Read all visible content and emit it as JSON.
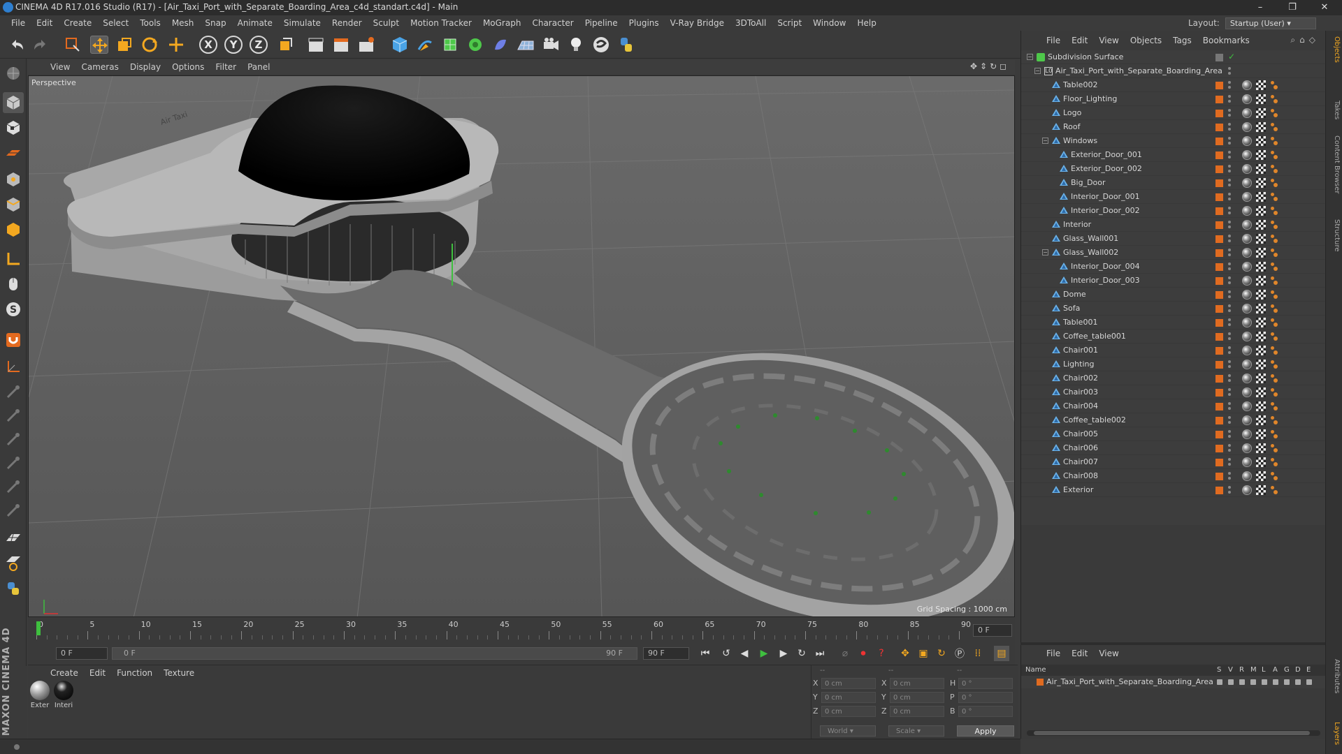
{
  "window": {
    "title": "CINEMA 4D R17.016 Studio (R17) - [Air_Taxi_Port_with_Separate_Boarding_Area_c4d_standart.c4d] - Main",
    "minimize": "–",
    "maximize": "❐",
    "close": "✕"
  },
  "menu": [
    "File",
    "Edit",
    "Create",
    "Select",
    "Tools",
    "Mesh",
    "Snap",
    "Animate",
    "Simulate",
    "Render",
    "Sculpt",
    "Motion Tracker",
    "MoGraph",
    "Character",
    "Pipeline",
    "Plugins",
    "V-Ray Bridge",
    "3DToAll",
    "Script",
    "Window",
    "Help"
  ],
  "layout": {
    "label": "Layout:",
    "value": "Startup (User)"
  },
  "toolbar_axes": [
    "X",
    "Y",
    "Z"
  ],
  "viewport": {
    "menu": [
      "View",
      "Cameras",
      "Display",
      "Options",
      "Filter",
      "Panel"
    ],
    "label": "Perspective",
    "grid_spacing": "Grid Spacing : 1000 cm"
  },
  "timeline": {
    "ticks": [
      "0",
      "5",
      "10",
      "15",
      "20",
      "25",
      "30",
      "35",
      "40",
      "45",
      "50",
      "55",
      "60",
      "65",
      "70",
      "75",
      "80",
      "85",
      "90"
    ],
    "current_frame": "0 F",
    "start_field": "0 F",
    "range_start": "0 F",
    "range_end": "90 F",
    "end_field": "90 F"
  },
  "materials": {
    "menu": [
      "Create",
      "Edit",
      "Function",
      "Texture"
    ],
    "items": [
      {
        "label": "Exter"
      },
      {
        "label": "Interi"
      }
    ]
  },
  "coords": {
    "headers": [
      "--",
      "--",
      "--"
    ],
    "rows": [
      {
        "a": "X",
        "av": "0 cm",
        "b": "X",
        "bv": "0 cm",
        "c": "H",
        "cv": "0 °"
      },
      {
        "a": "Y",
        "av": "0 cm",
        "b": "Y",
        "bv": "0 cm",
        "c": "P",
        "cv": "0 °"
      },
      {
        "a": "Z",
        "av": "0 cm",
        "b": "Z",
        "bv": "0 cm",
        "c": "B",
        "cv": "0 °"
      }
    ],
    "world": "World",
    "scale": "Scale",
    "apply": "Apply"
  },
  "objects": {
    "menu": [
      "File",
      "Edit",
      "View",
      "Objects",
      "Tags",
      "Bookmarks"
    ],
    "tree": [
      {
        "name": "Subdivision Surface",
        "level": 0,
        "type": "subdiv",
        "tags": false
      },
      {
        "name": "Air_Taxi_Port_with_Separate_Boarding_Area",
        "level": 1,
        "type": "null",
        "tags": false
      },
      {
        "name": "Table002",
        "level": 2,
        "type": "obj",
        "tags": true
      },
      {
        "name": "Floor_Lighting",
        "level": 2,
        "type": "obj",
        "tags": true
      },
      {
        "name": "Logo",
        "level": 2,
        "type": "obj",
        "tags": true
      },
      {
        "name": "Roof",
        "level": 2,
        "type": "obj",
        "tags": true
      },
      {
        "name": "Windows",
        "level": 2,
        "type": "obj",
        "tags": true,
        "expanded": true
      },
      {
        "name": "Exterior_Door_001",
        "level": 3,
        "type": "obj",
        "tags": true
      },
      {
        "name": "Exterior_Door_002",
        "level": 3,
        "type": "obj",
        "tags": true
      },
      {
        "name": "Big_Door",
        "level": 3,
        "type": "obj",
        "tags": true
      },
      {
        "name": "Interior_Door_001",
        "level": 3,
        "type": "obj",
        "tags": true
      },
      {
        "name": "Interior_Door_002",
        "level": 3,
        "type": "obj",
        "tags": true
      },
      {
        "name": "Interior",
        "level": 2,
        "type": "obj",
        "tags": true
      },
      {
        "name": "Glass_Wall001",
        "level": 2,
        "type": "obj",
        "tags": true
      },
      {
        "name": "Glass_Wall002",
        "level": 2,
        "type": "obj",
        "tags": true,
        "expanded": true
      },
      {
        "name": "Interior_Door_004",
        "level": 3,
        "type": "obj",
        "tags": true
      },
      {
        "name": "Interior_Door_003",
        "level": 3,
        "type": "obj",
        "tags": true
      },
      {
        "name": "Dome",
        "level": 2,
        "type": "obj",
        "tags": true
      },
      {
        "name": "Sofa",
        "level": 2,
        "type": "obj",
        "tags": true
      },
      {
        "name": "Table001",
        "level": 2,
        "type": "obj",
        "tags": true
      },
      {
        "name": "Coffee_table001",
        "level": 2,
        "type": "obj",
        "tags": true
      },
      {
        "name": "Chair001",
        "level": 2,
        "type": "obj",
        "tags": true
      },
      {
        "name": "Lighting",
        "level": 2,
        "type": "obj",
        "tags": true
      },
      {
        "name": "Chair002",
        "level": 2,
        "type": "obj",
        "tags": true
      },
      {
        "name": "Chair003",
        "level": 2,
        "type": "obj",
        "tags": true
      },
      {
        "name": "Chair004",
        "level": 2,
        "type": "obj",
        "tags": true
      },
      {
        "name": "Coffee_table002",
        "level": 2,
        "type": "obj",
        "tags": true
      },
      {
        "name": "Chair005",
        "level": 2,
        "type": "obj",
        "tags": true
      },
      {
        "name": "Chair006",
        "level": 2,
        "type": "obj",
        "tags": true
      },
      {
        "name": "Chair007",
        "level": 2,
        "type": "obj",
        "tags": true
      },
      {
        "name": "Chair008",
        "level": 2,
        "type": "obj",
        "tags": true
      },
      {
        "name": "Exterior",
        "level": 2,
        "type": "obj",
        "tags": true
      }
    ]
  },
  "layers": {
    "menu": [
      "File",
      "Edit",
      "View"
    ],
    "header_name": "Name",
    "header_flags": [
      "S",
      "V",
      "R",
      "M",
      "L",
      "A",
      "G",
      "D",
      "E"
    ],
    "row": "Air_Taxi_Port_with_Separate_Boarding_Area"
  },
  "right_tabs": [
    "Objects",
    "Takes",
    "Content Browser",
    "Structure",
    "Attributes",
    "Layers"
  ],
  "brand": "MAXON CINEMA 4D",
  "colors": {
    "accent": "#e06b20",
    "selection": "#4a90d9",
    "play": "#3fbf3f",
    "record": "#d33"
  }
}
